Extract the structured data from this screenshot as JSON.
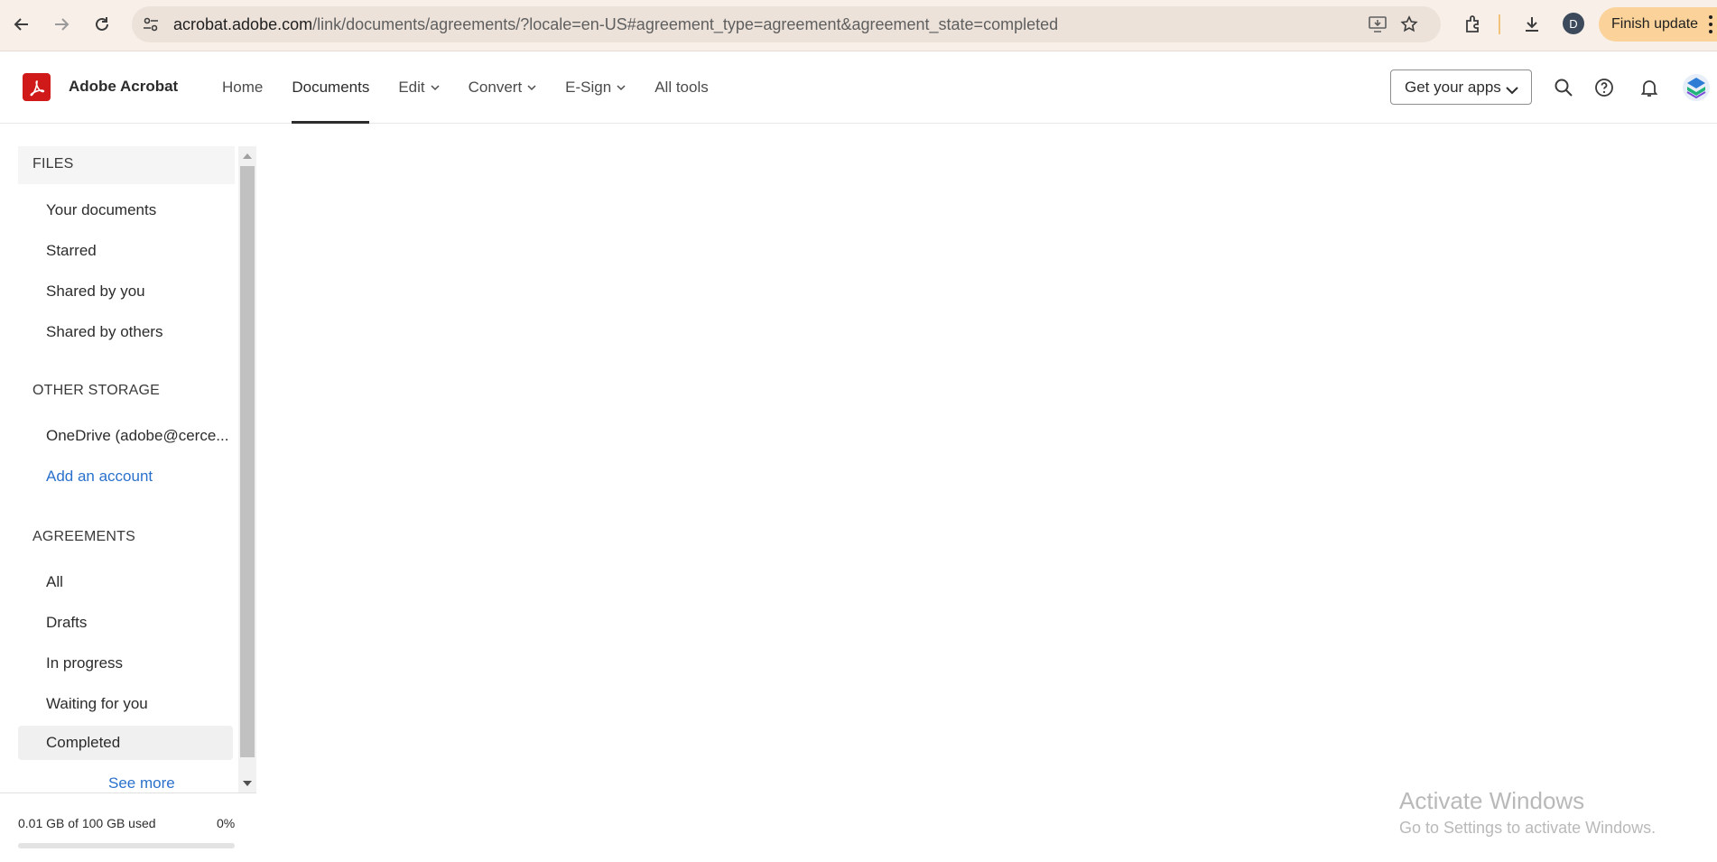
{
  "browser": {
    "url_host": "acrobat.adobe.com",
    "url_path": "/link/documents/agreements/?locale=en-US#agreement_type=agreement&agreement_state=completed",
    "profile_initial": "D",
    "finish_update_label": "Finish update"
  },
  "app": {
    "name": "Adobe Acrobat",
    "nav": [
      {
        "label": "Home"
      },
      {
        "label": "Documents"
      },
      {
        "label": "Edit"
      },
      {
        "label": "Convert"
      },
      {
        "label": "E-Sign"
      },
      {
        "label": "All tools"
      }
    ],
    "get_apps_label": "Get your apps"
  },
  "sidebar": {
    "files_title": "FILES",
    "files_items": [
      "Your documents",
      "Starred",
      "Shared by you",
      "Shared by others"
    ],
    "other_storage_title": "OTHER STORAGE",
    "other_storage_items": [
      "OneDrive (adobe@cerce...",
      "Add an account"
    ],
    "agreements_title": "AGREEMENTS",
    "agreements_items": [
      "All",
      "Drafts",
      "In progress",
      "Waiting for you",
      "Completed"
    ],
    "see_more": "See more",
    "storage_used": "0.01 GB of 100 GB used",
    "storage_percent_label": "0%",
    "storage_fraction": 0.0
  },
  "watermark": {
    "title": "Activate Windows",
    "subtitle": "Go to Settings to activate Windows."
  },
  "colors": {
    "brand_red": "#d01a1a",
    "link_blue": "#2a71cc",
    "update_pill": "#fbd39a"
  }
}
